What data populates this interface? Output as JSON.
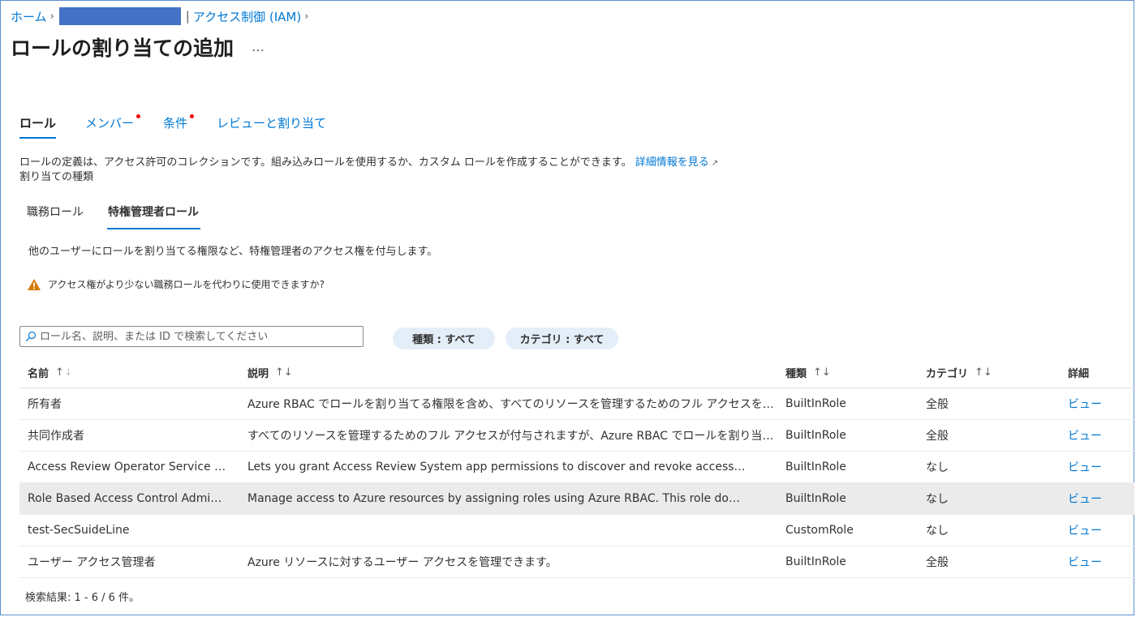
{
  "breadcrumb": {
    "home": "ホーム",
    "iam": "アクセス制御 (IAM)"
  },
  "page": {
    "title": "ロールの割り当ての追加",
    "more": "…"
  },
  "wizard_tabs": [
    {
      "label": "ロール",
      "active": true
    },
    {
      "label": "メンバー",
      "required": true
    },
    {
      "label": "条件",
      "required": true
    },
    {
      "label": "レビューと割り当て"
    }
  ],
  "intro": {
    "text": "ロールの定義は、アクセス許可のコレクションです。組み込みロールを使用するか、カスタム ロールを作成することができます。",
    "link": "詳細情報を見る",
    "assignment_type_label": "割り当ての種類"
  },
  "sub_tabs": [
    {
      "label": "職務ロール"
    },
    {
      "label": "特権管理者ロール",
      "active": true
    }
  ],
  "sub_description": "他のユーザーにロールを割り当てる権限など、特権管理者のアクセス権を付与します。",
  "warning": "アクセス権がより少ない職務ロールを代わりに使用できますか?",
  "search": {
    "placeholder": "ロール名、説明、または ID で検索してください",
    "value": ""
  },
  "filters": {
    "type": "種類 : すべて",
    "category": "カテゴリ : すべて"
  },
  "table": {
    "headers": {
      "name": "名前",
      "description": "説明",
      "type": "種類",
      "category": "カテゴリ",
      "details": "詳細"
    },
    "rows": [
      {
        "name": "所有者",
        "description": "Azure RBAC でロールを割り当てる権限を含め、すべてのリソースを管理するためのフル アクセスを付与しま…",
        "type": "BuiltInRole",
        "category": "全般",
        "view": "ビュー"
      },
      {
        "name": "共同作成者",
        "description": "すべてのリソースを管理するためのフル アクセスが付与されますが、Azure RBAC でロールを割り当てたり、A…",
        "type": "BuiltInRole",
        "category": "全般",
        "view": "ビュー"
      },
      {
        "name": "Access Review Operator Service …",
        "description": "Lets you grant Access Review System app permissions to discover and revoke access…",
        "type": "BuiltInRole",
        "category": "なし",
        "view": "ビュー"
      },
      {
        "name": "Role Based Access Control Admi…",
        "description": "Manage access to Azure resources by assigning roles using Azure RBAC. This role do…",
        "type": "BuiltInRole",
        "category": "なし",
        "view": "ビュー",
        "selected": true
      },
      {
        "name": "test-SecSuideLine",
        "description": "",
        "type": "CustomRole",
        "category": "なし",
        "view": "ビュー"
      },
      {
        "name": "ユーザー アクセス管理者",
        "description": "Azure リソースに対するユーザー アクセスを管理できます。",
        "type": "BuiltInRole",
        "category": "全般",
        "view": "ビュー"
      }
    ]
  },
  "result_count": "検索結果: 1 - 6 / 6 件。",
  "colors": {
    "accent": "#0078d4",
    "required_dot": "#e00000",
    "warning": "#d47800",
    "pill_bg": "#e4eef9",
    "selected_row": "#ebebeb"
  }
}
